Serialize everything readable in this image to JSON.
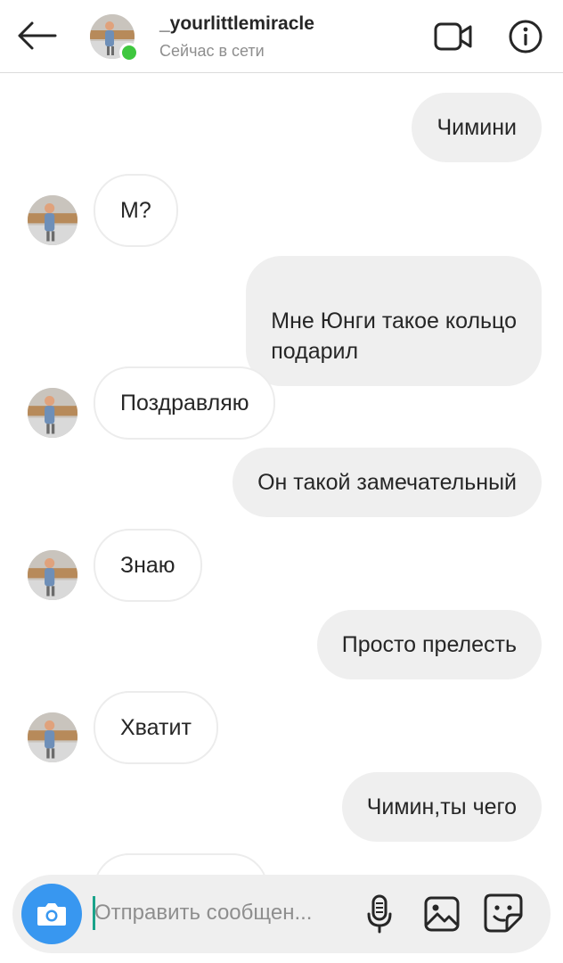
{
  "header": {
    "username": "_yourlittlemiracle",
    "status": "Сейчас в сети",
    "online_color": "#3ec73e",
    "icons": {
      "back": "arrow-left-icon",
      "video": "video-camera-icon",
      "info": "info-icon"
    }
  },
  "messages": [
    {
      "side": "out",
      "text": "Чимини"
    },
    {
      "side": "in",
      "text": "М?"
    },
    {
      "side": "out",
      "text": "Мне Юнги такое кольцо\nподарил"
    },
    {
      "side": "in",
      "text": "Поздравляю"
    },
    {
      "side": "out",
      "text": "Он такой замечательный"
    },
    {
      "side": "in",
      "text": "Знаю"
    },
    {
      "side": "out",
      "text": "Просто прелесть"
    },
    {
      "side": "in",
      "text": "Хватит"
    },
    {
      "side": "out",
      "text": "Чимин,ты чего"
    },
    {
      "side": "in",
      "text": ""
    }
  ],
  "composer": {
    "placeholder": "Отправить сообщен...",
    "value": "",
    "accent_color": "#3897f0",
    "icons": {
      "camera": "camera-icon",
      "mic": "microphone-icon",
      "gallery": "image-icon",
      "sticker": "sticker-icon"
    }
  }
}
